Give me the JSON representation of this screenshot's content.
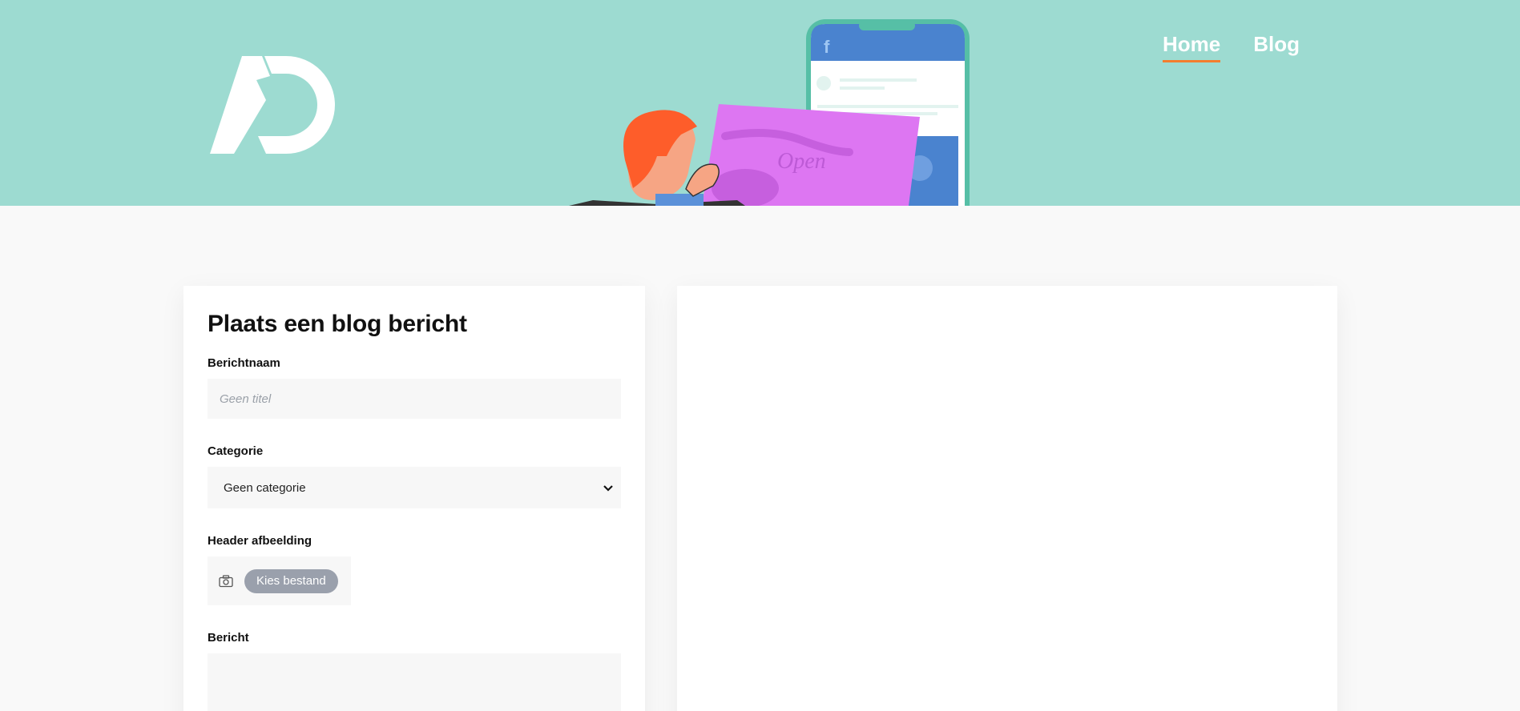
{
  "nav": {
    "items": [
      {
        "label": "Home",
        "active": true
      },
      {
        "label": "Blog",
        "active": false
      }
    ]
  },
  "colors": {
    "hero_bg": "#9ddbd1",
    "nav_accent": "#f47d2e",
    "page_bg": "#f9f9f9"
  },
  "form": {
    "title": "Plaats een blog bericht",
    "name_label": "Berichtnaam",
    "name_placeholder": "Geen titel",
    "category_label": "Categorie",
    "category_selected": "Geen categorie",
    "image_label": "Header afbeelding",
    "file_button": "Kies bestand",
    "message_label": "Bericht"
  }
}
